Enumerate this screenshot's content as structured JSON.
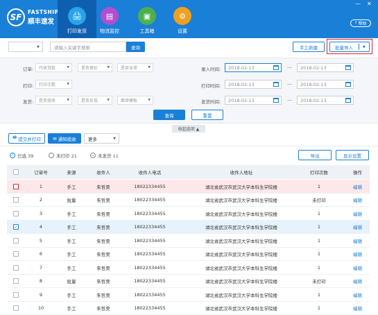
{
  "brand": {
    "en": "FASTSHIP",
    "cn": "顺丰速发",
    "mark": "SF"
  },
  "nav": [
    {
      "label": "打印发货",
      "icon": "printer-icon",
      "color": "#2aa3e8",
      "glyph": "🖨"
    },
    {
      "label": "物流监控",
      "icon": "monitor-icon",
      "color": "#b04fcf",
      "glyph": "▤"
    },
    {
      "label": "工具箱",
      "icon": "toolbox-icon",
      "color": "#4cb050",
      "glyph": "▣"
    },
    {
      "label": "设置",
      "icon": "gear-icon",
      "color": "#f0a020",
      "glyph": "⚙"
    }
  ],
  "window": {
    "minimize": "—",
    "close": "✕"
  },
  "help": {
    "label": "帮助"
  },
  "search": {
    "placeholder": "请输入关键字搜索",
    "button": "查询"
  },
  "actions": {
    "manual_new": "手工新建",
    "bulk_import": "批量导入",
    "bulk_caret": "▼"
  },
  "filters": {
    "order_label": "订单:",
    "order_selects": [
      "代收货款",
      "是否保价",
      "是否含单"
    ],
    "print_label": "打印:",
    "print_select": "打印次数",
    "ship_label": "发货:",
    "ship_selects": [
      "是否揽收",
      "是否妥投",
      "面单模板"
    ],
    "entry_time_label": "录入时间:",
    "print_time_label": "打印时间:",
    "ship_time_label": "发货时间:",
    "date_from": "2018-02-13",
    "date_to": "2018-02-13",
    "dash": "—",
    "query": "查询",
    "reset": "重置",
    "collapse": "收起选项 ▲"
  },
  "toolbar": {
    "submit_print": "提交并打印",
    "notify_pickup": "通知揽收",
    "more": "更多"
  },
  "summary": {
    "selected": "已选 39",
    "unprinted": "未打印 21",
    "unshipped": "未发货 11",
    "export": "导出",
    "display_settings": "显示设置"
  },
  "table": {
    "columns": [
      "订单号",
      "来源",
      "收件人",
      "收件人电话",
      "收件人地址",
      "打印次数",
      "操作"
    ],
    "rows": [
      {
        "no": "1",
        "source": "手工",
        "name": "朱哲昊",
        "phone": "18022334455",
        "address": "湖北省武汉市武汉大学本科生学院楼",
        "prints": "1",
        "op": "编辑",
        "style": "pink"
      },
      {
        "no": "2",
        "source": "批量",
        "name": "朱哲昊",
        "phone": "18022334455",
        "address": "湖北省武汉市武汉大学本科生学院楼",
        "prints": "未打印",
        "op": "编辑",
        "style": ""
      },
      {
        "no": "3",
        "source": "手工",
        "name": "朱哲昊",
        "phone": "18022334455",
        "address": "湖北省武汉市武汉大学本科生学院楼",
        "prints": "1",
        "op": "编辑",
        "style": ""
      },
      {
        "no": "4",
        "source": "手工",
        "name": "朱哲昊",
        "phone": "18022334455",
        "address": "湖北省武汉市武汉大学本科生学院楼",
        "prints": "1",
        "op": "编辑",
        "style": "blue",
        "checked": true
      },
      {
        "no": "5",
        "source": "手工",
        "name": "朱哲昊",
        "phone": "18022334455",
        "address": "湖北省武汉市武汉大学本科生学院楼",
        "prints": "1",
        "op": "编辑",
        "style": ""
      },
      {
        "no": "6",
        "source": "手工",
        "name": "朱哲昊",
        "phone": "18022334455",
        "address": "湖北省武汉市武汉大学本科生学院楼",
        "prints": "1",
        "op": "编辑",
        "style": ""
      },
      {
        "no": "7",
        "source": "手工",
        "name": "朱哲昊",
        "phone": "18022334455",
        "address": "湖北省武汉市武汉大学本科生学院楼",
        "prints": "1",
        "op": "编辑",
        "style": ""
      },
      {
        "no": "8",
        "source": "批量",
        "name": "朱哲昊",
        "phone": "18022334455",
        "address": "湖北省武汉市武汉大学本科生学院楼",
        "prints": "未打印",
        "op": "编辑",
        "style": ""
      },
      {
        "no": "9",
        "source": "手工",
        "name": "朱哲昊",
        "phone": "18022334455",
        "address": "湖北省武汉市武汉大学本科生学院楼",
        "prints": "1",
        "op": "编辑",
        "style": ""
      },
      {
        "no": "10",
        "source": "手工",
        "name": "朱哲昊",
        "phone": "18022334455",
        "address": "湖北省武汉市武汉大学本科生学院楼",
        "prints": "1",
        "op": "编辑",
        "style": ""
      }
    ]
  },
  "colors": {
    "primary": "#1a7fd6",
    "highlight": "#d9232e"
  }
}
